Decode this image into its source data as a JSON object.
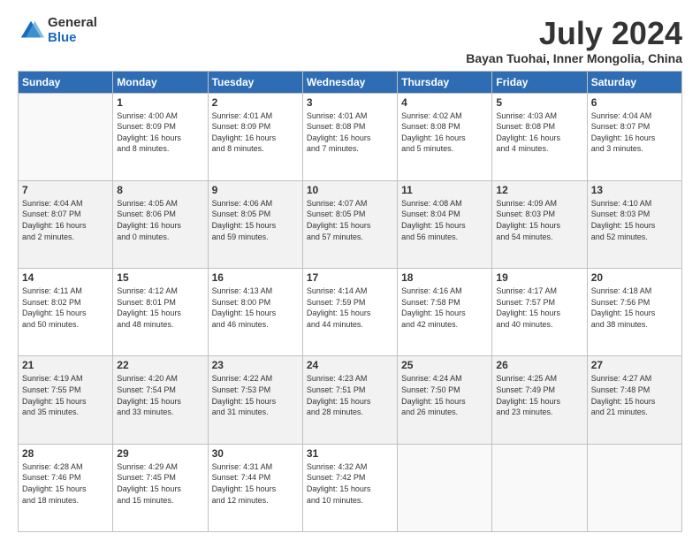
{
  "logo": {
    "general": "General",
    "blue": "Blue"
  },
  "title": "July 2024",
  "subtitle": "Bayan Tuohai, Inner Mongolia, China",
  "days": [
    "Sunday",
    "Monday",
    "Tuesday",
    "Wednesday",
    "Thursday",
    "Friday",
    "Saturday"
  ],
  "weeks": [
    [
      {
        "day": "",
        "info": ""
      },
      {
        "day": "1",
        "info": "Sunrise: 4:00 AM\nSunset: 8:09 PM\nDaylight: 16 hours\nand 8 minutes."
      },
      {
        "day": "2",
        "info": "Sunrise: 4:01 AM\nSunset: 8:09 PM\nDaylight: 16 hours\nand 8 minutes."
      },
      {
        "day": "3",
        "info": "Sunrise: 4:01 AM\nSunset: 8:08 PM\nDaylight: 16 hours\nand 7 minutes."
      },
      {
        "day": "4",
        "info": "Sunrise: 4:02 AM\nSunset: 8:08 PM\nDaylight: 16 hours\nand 5 minutes."
      },
      {
        "day": "5",
        "info": "Sunrise: 4:03 AM\nSunset: 8:08 PM\nDaylight: 16 hours\nand 4 minutes."
      },
      {
        "day": "6",
        "info": "Sunrise: 4:04 AM\nSunset: 8:07 PM\nDaylight: 16 hours\nand 3 minutes."
      }
    ],
    [
      {
        "day": "7",
        "info": "Sunrise: 4:04 AM\nSunset: 8:07 PM\nDaylight: 16 hours\nand 2 minutes."
      },
      {
        "day": "8",
        "info": "Sunrise: 4:05 AM\nSunset: 8:06 PM\nDaylight: 16 hours\nand 0 minutes."
      },
      {
        "day": "9",
        "info": "Sunrise: 4:06 AM\nSunset: 8:05 PM\nDaylight: 15 hours\nand 59 minutes."
      },
      {
        "day": "10",
        "info": "Sunrise: 4:07 AM\nSunset: 8:05 PM\nDaylight: 15 hours\nand 57 minutes."
      },
      {
        "day": "11",
        "info": "Sunrise: 4:08 AM\nSunset: 8:04 PM\nDaylight: 15 hours\nand 56 minutes."
      },
      {
        "day": "12",
        "info": "Sunrise: 4:09 AM\nSunset: 8:03 PM\nDaylight: 15 hours\nand 54 minutes."
      },
      {
        "day": "13",
        "info": "Sunrise: 4:10 AM\nSunset: 8:03 PM\nDaylight: 15 hours\nand 52 minutes."
      }
    ],
    [
      {
        "day": "14",
        "info": "Sunrise: 4:11 AM\nSunset: 8:02 PM\nDaylight: 15 hours\nand 50 minutes."
      },
      {
        "day": "15",
        "info": "Sunrise: 4:12 AM\nSunset: 8:01 PM\nDaylight: 15 hours\nand 48 minutes."
      },
      {
        "day": "16",
        "info": "Sunrise: 4:13 AM\nSunset: 8:00 PM\nDaylight: 15 hours\nand 46 minutes."
      },
      {
        "day": "17",
        "info": "Sunrise: 4:14 AM\nSunset: 7:59 PM\nDaylight: 15 hours\nand 44 minutes."
      },
      {
        "day": "18",
        "info": "Sunrise: 4:16 AM\nSunset: 7:58 PM\nDaylight: 15 hours\nand 42 minutes."
      },
      {
        "day": "19",
        "info": "Sunrise: 4:17 AM\nSunset: 7:57 PM\nDaylight: 15 hours\nand 40 minutes."
      },
      {
        "day": "20",
        "info": "Sunrise: 4:18 AM\nSunset: 7:56 PM\nDaylight: 15 hours\nand 38 minutes."
      }
    ],
    [
      {
        "day": "21",
        "info": "Sunrise: 4:19 AM\nSunset: 7:55 PM\nDaylight: 15 hours\nand 35 minutes."
      },
      {
        "day": "22",
        "info": "Sunrise: 4:20 AM\nSunset: 7:54 PM\nDaylight: 15 hours\nand 33 minutes."
      },
      {
        "day": "23",
        "info": "Sunrise: 4:22 AM\nSunset: 7:53 PM\nDaylight: 15 hours\nand 31 minutes."
      },
      {
        "day": "24",
        "info": "Sunrise: 4:23 AM\nSunset: 7:51 PM\nDaylight: 15 hours\nand 28 minutes."
      },
      {
        "day": "25",
        "info": "Sunrise: 4:24 AM\nSunset: 7:50 PM\nDaylight: 15 hours\nand 26 minutes."
      },
      {
        "day": "26",
        "info": "Sunrise: 4:25 AM\nSunset: 7:49 PM\nDaylight: 15 hours\nand 23 minutes."
      },
      {
        "day": "27",
        "info": "Sunrise: 4:27 AM\nSunset: 7:48 PM\nDaylight: 15 hours\nand 21 minutes."
      }
    ],
    [
      {
        "day": "28",
        "info": "Sunrise: 4:28 AM\nSunset: 7:46 PM\nDaylight: 15 hours\nand 18 minutes."
      },
      {
        "day": "29",
        "info": "Sunrise: 4:29 AM\nSunset: 7:45 PM\nDaylight: 15 hours\nand 15 minutes."
      },
      {
        "day": "30",
        "info": "Sunrise: 4:31 AM\nSunset: 7:44 PM\nDaylight: 15 hours\nand 12 minutes."
      },
      {
        "day": "31",
        "info": "Sunrise: 4:32 AM\nSunset: 7:42 PM\nDaylight: 15 hours\nand 10 minutes."
      },
      {
        "day": "",
        "info": ""
      },
      {
        "day": "",
        "info": ""
      },
      {
        "day": "",
        "info": ""
      }
    ]
  ]
}
